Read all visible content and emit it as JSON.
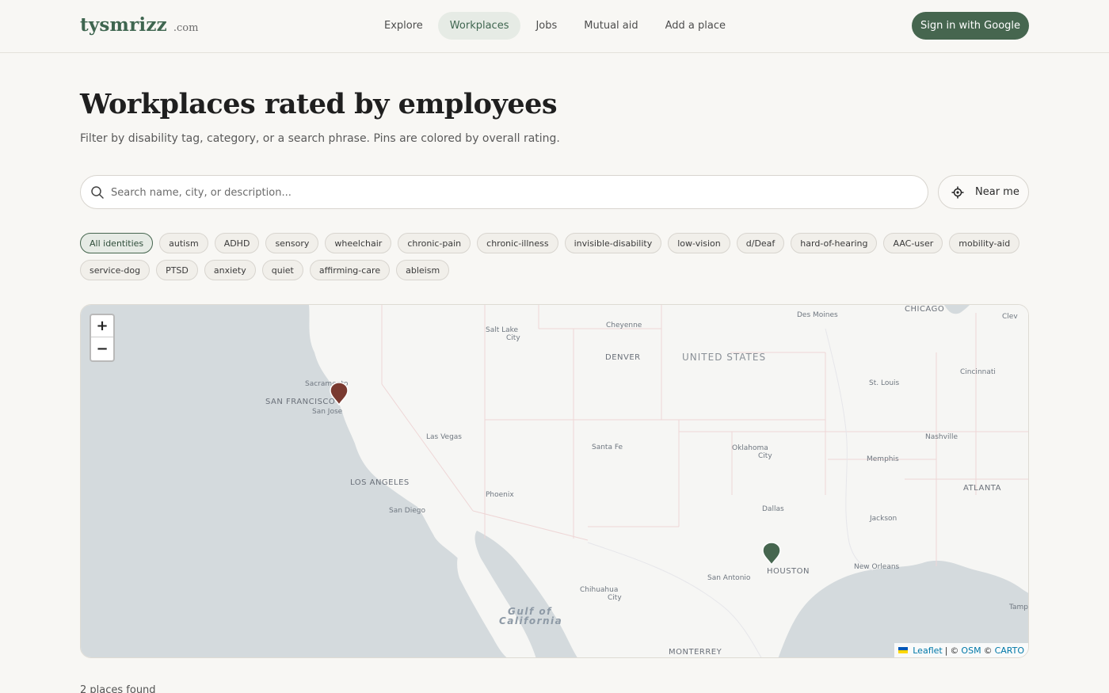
{
  "header": {
    "logo_main": "tysmrizz",
    "logo_tld": ".com",
    "nav": [
      "Explore",
      "Workplaces",
      "Jobs",
      "Mutual aid",
      "Add a place"
    ],
    "active_nav": "Workplaces",
    "signin_label": "Sign in with Google"
  },
  "hero": {
    "title": "Workplaces rated by employees",
    "subtitle": "Filter by disability tag, category, or a search phrase. Pins are colored by overall rating."
  },
  "search": {
    "placeholder": "Search name, city, or description...",
    "value": "",
    "near_me_label": "Near me"
  },
  "tags": {
    "items": [
      "All identities",
      "autism",
      "ADHD",
      "sensory",
      "wheelchair",
      "chronic-pain",
      "chronic-illness",
      "invisible-disability",
      "low-vision",
      "d/Deaf",
      "hard-of-hearing",
      "AAC-user",
      "mobility-aid",
      "service-dog",
      "PTSD",
      "anxiety",
      "quiet",
      "affirming-care",
      "ableism"
    ],
    "selected": "All identities"
  },
  "map": {
    "zoom_in": "+",
    "zoom_out": "−",
    "labels": {
      "chicago": "CHICAGO",
      "des_moines": "Des Moines",
      "cheyenne": "Cheyenne",
      "salt_lake_1": "Salt Lake",
      "salt_lake_2": "City",
      "denver": "DENVER",
      "united_states": "UNITED STATES",
      "cleveland": "Clev",
      "cincinnati": "Cincinnati",
      "st_louis": "St. Louis",
      "sacramento": "Sacramento",
      "san_francisco": "SAN FRANCISCO",
      "san_jose": "San Jose",
      "las_vegas": "Las Vegas",
      "santa_fe": "Santa Fe",
      "oklahoma_1": "Oklahoma",
      "oklahoma_2": "City",
      "nashville": "Nashville",
      "memphis": "Memphis",
      "los_angeles": "LOS ANGELES",
      "phoenix": "Phoenix",
      "atlanta": "ATLANTA",
      "san_diego": "San Diego",
      "dallas": "Dallas",
      "jackson": "Jackson",
      "houston": "HOUSTON",
      "new_orleans": "New Orleans",
      "san_antonio": "San Antonio",
      "chihuahua_1": "Chihuahua",
      "chihuahua_2": "City",
      "gulf_1": "Gulf of",
      "gulf_2": "California",
      "tampa": "Tamp",
      "monterrey": "MONTERREY"
    },
    "pins": [
      {
        "name": "pin-san-francisco",
        "color": "#7a3a30"
      },
      {
        "name": "pin-houston",
        "color": "#46664f"
      }
    ],
    "attribution": {
      "leaflet": "Leaflet",
      "sep1": "|",
      "copy1": "©",
      "osm": "OSM",
      "copy2": "©",
      "carto": "CARTO"
    }
  },
  "results": {
    "count_text": "2 places found"
  },
  "colors": {
    "accent": "#46664f",
    "accent_light": "#e6ebe5",
    "pin_low": "#7a3a30",
    "pin_high": "#46664f",
    "water": "#d4dadd",
    "land": "#f6f6f4"
  }
}
